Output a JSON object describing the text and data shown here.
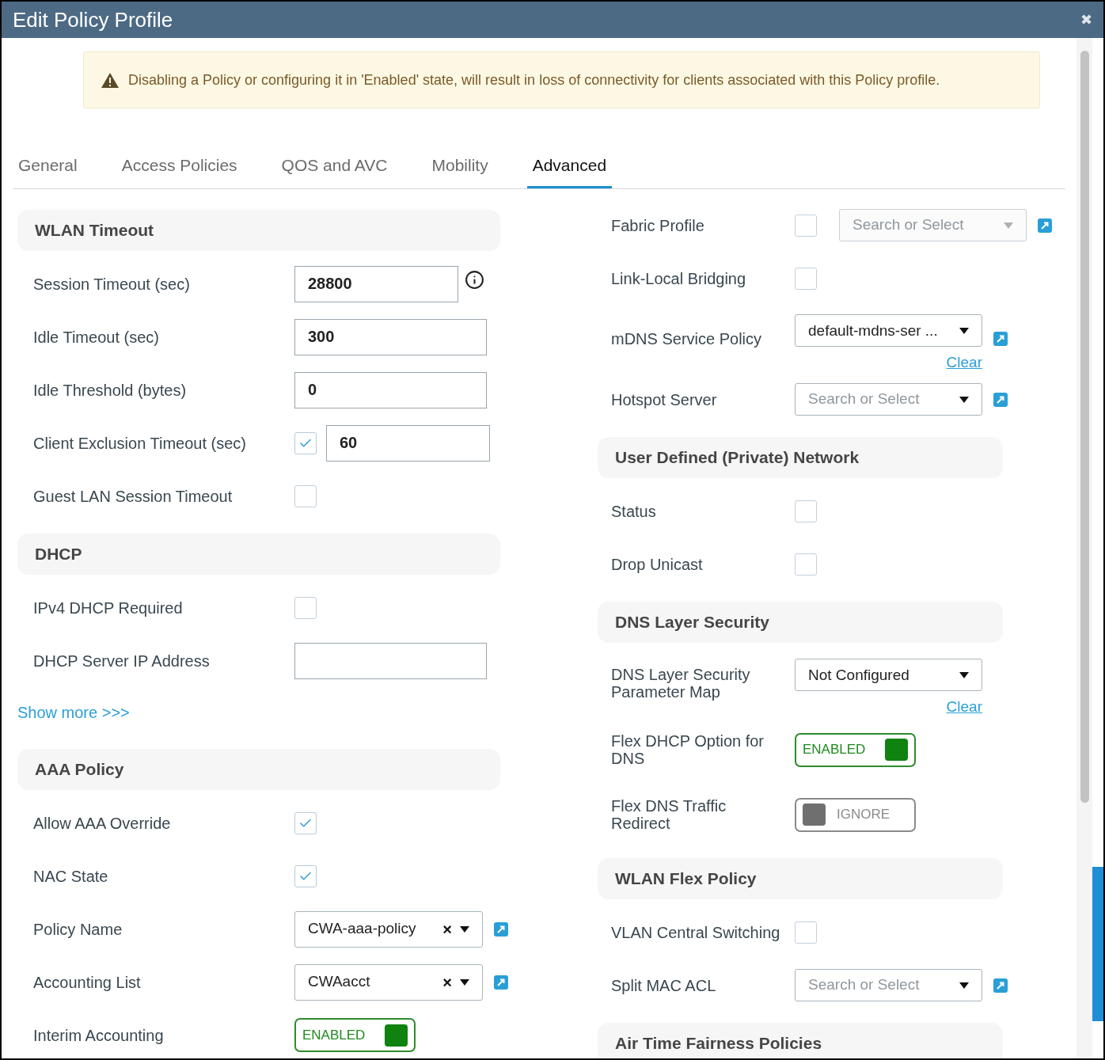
{
  "window": {
    "title": "Edit Policy Profile",
    "close": "✖"
  },
  "warning": "Disabling a Policy or configuring it in 'Enabled' state, will result in loss of connectivity for clients associated with this Policy profile.",
  "tabs": [
    {
      "label": "General",
      "selected": false
    },
    {
      "label": "Access Policies",
      "selected": false
    },
    {
      "label": "QOS and AVC",
      "selected": false
    },
    {
      "label": "Mobility",
      "selected": false
    },
    {
      "label": "Advanced",
      "selected": true
    }
  ],
  "columns": [
    [
      {
        "kind": "section",
        "title": "WLAN Timeout"
      },
      {
        "kind": "row",
        "label": "Session Timeout (sec)",
        "controls": [
          {
            "kind": "input",
            "value": "28800"
          },
          {
            "kind": "info"
          }
        ]
      },
      {
        "kind": "row",
        "label": "Idle Timeout (sec)",
        "controls": [
          {
            "kind": "input",
            "value": "300"
          }
        ]
      },
      {
        "kind": "row",
        "label": "Idle Threshold (bytes)",
        "controls": [
          {
            "kind": "input",
            "value": "0"
          }
        ]
      },
      {
        "kind": "row",
        "label": "Client Exclusion Timeout (sec)",
        "controls": [
          {
            "kind": "checkbox",
            "checked": true
          },
          {
            "kind": "input",
            "value": "60"
          }
        ]
      },
      {
        "kind": "row",
        "label": "Guest LAN Session Timeout",
        "controls": [
          {
            "kind": "checkbox",
            "checked": false
          }
        ]
      },
      {
        "kind": "section",
        "title": "DHCP"
      },
      {
        "kind": "row",
        "label": "IPv4 DHCP Required",
        "controls": [
          {
            "kind": "checkbox",
            "checked": false
          }
        ]
      },
      {
        "kind": "row",
        "label": "DHCP Server IP Address",
        "controls": [
          {
            "kind": "input"
          }
        ]
      },
      {
        "kind": "link",
        "text": "Show more >>>"
      },
      {
        "kind": "section",
        "title": "AAA Policy"
      },
      {
        "kind": "row",
        "label": "Allow AAA Override",
        "controls": [
          {
            "kind": "checkbox",
            "checked": true
          }
        ]
      },
      {
        "kind": "row",
        "label": "NAC State",
        "controls": [
          {
            "kind": "checkbox",
            "checked": true
          }
        ]
      },
      {
        "kind": "row",
        "label": "Policy Name",
        "controls": [
          {
            "kind": "select",
            "value": "CWA-aaa-policy",
            "remove": "×"
          },
          {
            "kind": "edit"
          }
        ]
      },
      {
        "kind": "row",
        "label": "Accounting List",
        "controls": [
          {
            "kind": "select",
            "value": "CWAacct",
            "remove": "×"
          },
          {
            "kind": "edit"
          }
        ]
      },
      {
        "kind": "row",
        "label": "Interim Accounting",
        "controls": [
          {
            "kind": "toggle",
            "text": "ENABLED",
            "on": true
          }
        ]
      }
    ],
    [
      {
        "kind": "row",
        "label": "Fabric Profile",
        "controls": [
          {
            "kind": "checkbox",
            "checked": false
          },
          {
            "kind": "select",
            "placeholder": "Search or Select",
            "disabled": true
          },
          {
            "kind": "edit"
          }
        ]
      },
      {
        "kind": "row",
        "label": "Link-Local Bridging",
        "controls": [
          {
            "kind": "checkbox",
            "checked": false
          }
        ]
      },
      {
        "kind": "row",
        "label": "mDNS Service Policy",
        "controls": [
          {
            "kind": "select",
            "value": "default-mdns-ser ...",
            "link": "Clear"
          },
          {
            "kind": "edit"
          }
        ]
      },
      {
        "kind": "row",
        "label": "Hotspot Server",
        "controls": [
          {
            "kind": "select",
            "placeholder": "Search or Select"
          },
          {
            "kind": "edit"
          }
        ]
      },
      {
        "kind": "section",
        "title": "User Defined (Private) Network"
      },
      {
        "kind": "row",
        "label": "Status",
        "controls": [
          {
            "kind": "checkbox",
            "checked": false
          }
        ]
      },
      {
        "kind": "row",
        "label": "Drop Unicast",
        "controls": [
          {
            "kind": "checkbox",
            "checked": false
          }
        ]
      },
      {
        "kind": "section",
        "title": "DNS Layer Security"
      },
      {
        "kind": "row",
        "label": "DNS Layer Security Parameter Map",
        "controls": [
          {
            "kind": "select",
            "value": "Not Configured",
            "link": "Clear"
          }
        ]
      },
      {
        "kind": "row",
        "label": "Flex DHCP Option for DNS",
        "controls": [
          {
            "kind": "toggle",
            "text": "ENABLED",
            "on": true
          }
        ]
      },
      {
        "kind": "row",
        "label": "Flex DNS Traffic Redirect",
        "controls": [
          {
            "kind": "toggle",
            "text": "IGNORE",
            "on": false
          }
        ]
      },
      {
        "kind": "section",
        "title": "WLAN Flex Policy"
      },
      {
        "kind": "row",
        "label": "VLAN Central Switching",
        "controls": [
          {
            "kind": "checkbox",
            "checked": false
          }
        ]
      },
      {
        "kind": "row",
        "label": "Split MAC ACL",
        "controls": [
          {
            "kind": "select",
            "placeholder": "Search or Select"
          },
          {
            "kind": "edit"
          }
        ]
      },
      {
        "kind": "section",
        "title": "Air Time Fairness Policies"
      }
    ]
  ]
}
